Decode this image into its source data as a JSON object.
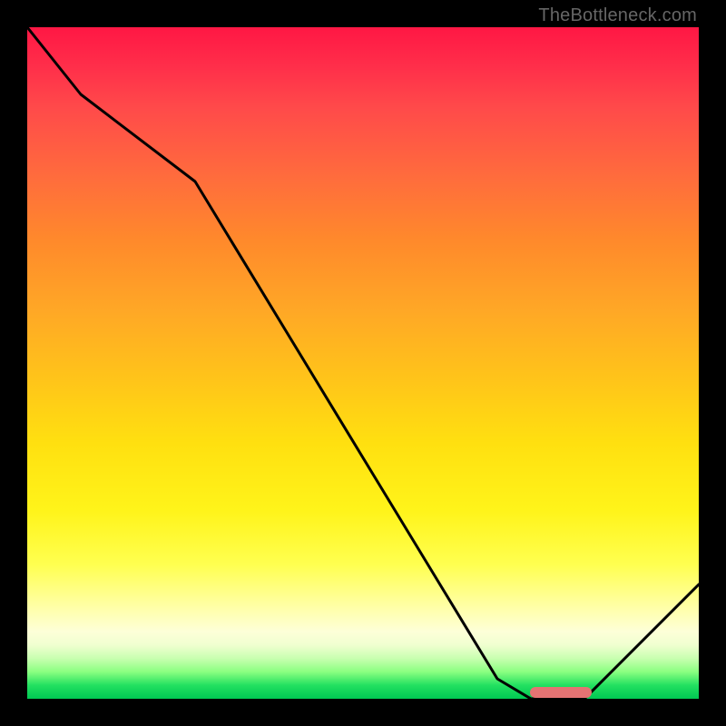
{
  "attribution": "TheBottleneck.com",
  "chart_data": {
    "type": "line",
    "title": "",
    "xlabel": "",
    "ylabel": "",
    "xlim": [
      0,
      100
    ],
    "ylim": [
      0,
      100
    ],
    "series": [
      {
        "name": "bottleneck-curve",
        "x": [
          0,
          8,
          25,
          70,
          75,
          83,
          100
        ],
        "values": [
          100,
          90,
          77,
          3,
          0,
          0,
          17
        ]
      }
    ],
    "marker": {
      "name": "optimal-range",
      "x_start": 75,
      "x_end": 84,
      "y": 0.5
    },
    "gradient_note": "vertical heatmap: red (top, high bottleneck) to green (bottom, low bottleneck)"
  },
  "colors": {
    "frame": "#000000",
    "line": "#000000",
    "marker": "#e57373",
    "attribution_text": "#666666"
  }
}
